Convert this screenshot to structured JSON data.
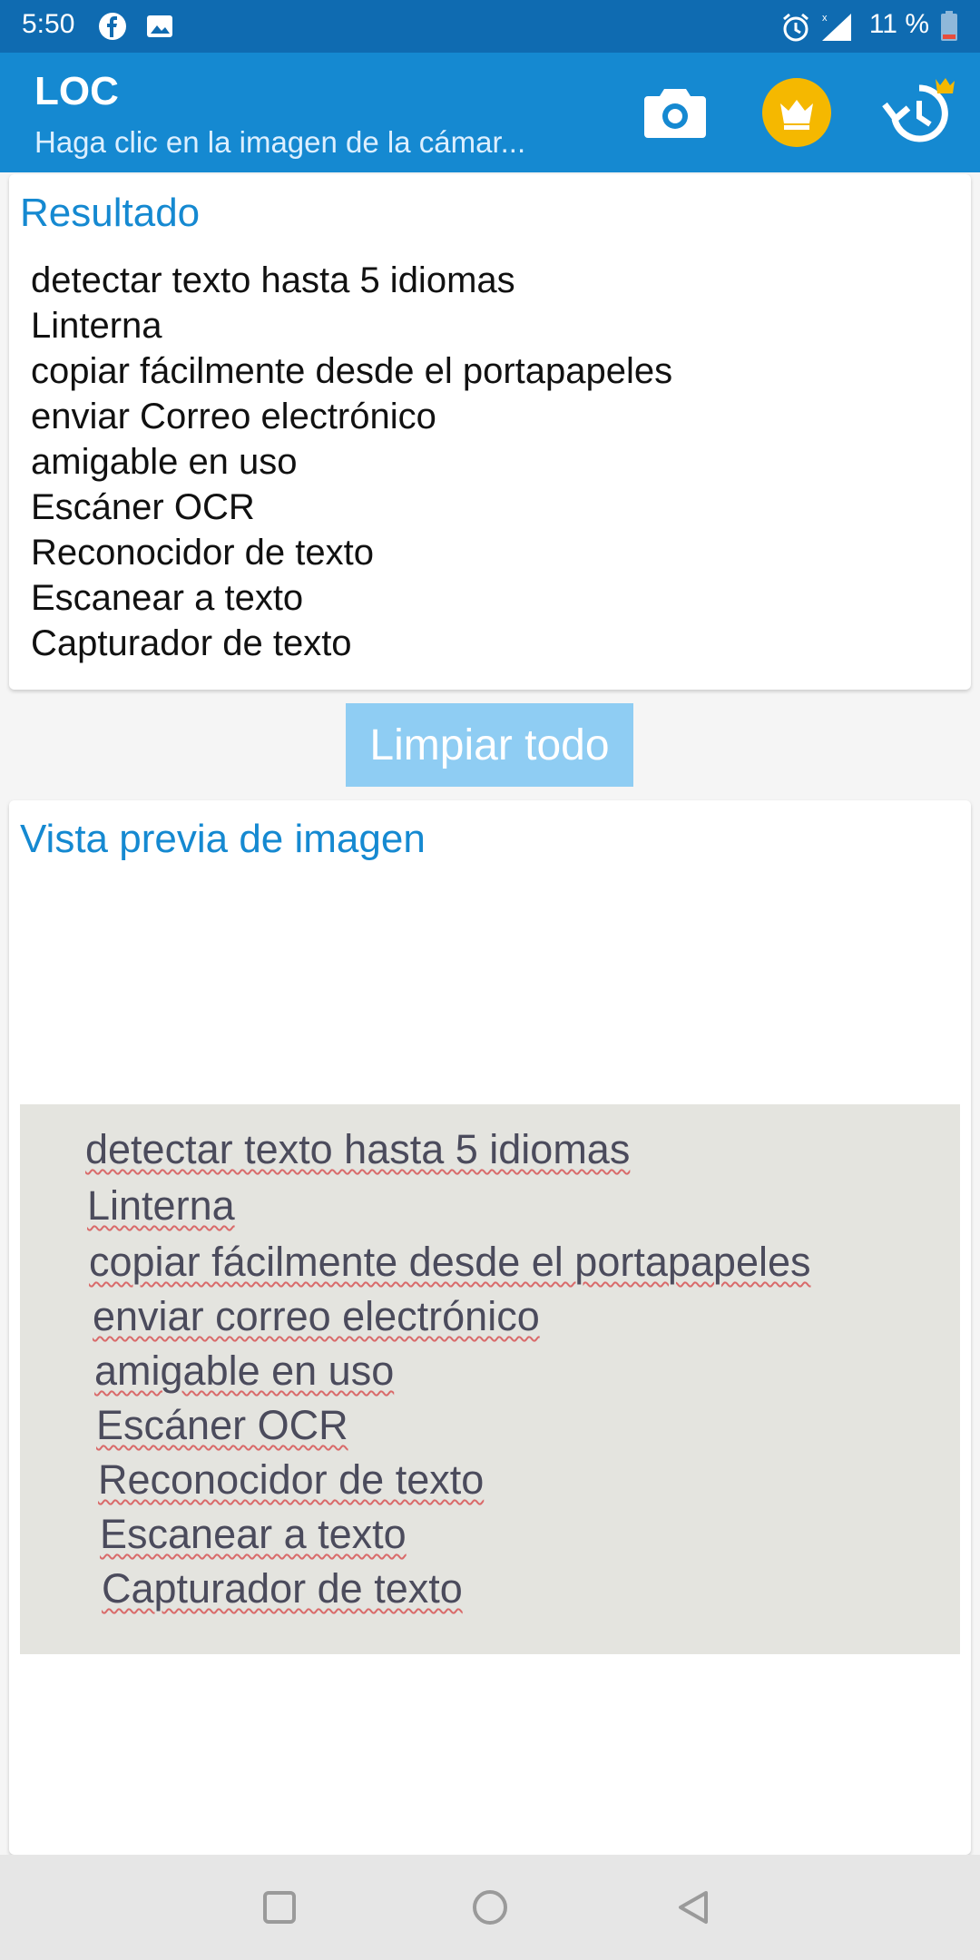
{
  "status_bar": {
    "time": "5:50",
    "battery": "11 %",
    "icons": [
      "facebook-icon",
      "image-icon",
      "alarm-icon",
      "signal-icon",
      "battery-icon"
    ]
  },
  "app_bar": {
    "title": "LOC",
    "subtitle": "Haga clic en la imagen de la cámar...",
    "actions": [
      "camera-icon",
      "crown-icon",
      "history-icon"
    ],
    "colors": {
      "bar": "#1589d1",
      "status": "#0f6bb1",
      "crown_bg": "#f5b800"
    }
  },
  "result": {
    "heading": "Resultado",
    "lines": [
      "detectar texto hasta 5 idiomas",
      "Linterna",
      "copiar fácilmente desde el portapapeles",
      "enviar Correo electrónico",
      "amigable en uso",
      "Escáner OCR",
      "Reconocidor de texto",
      "Escanear a texto",
      "Capturador de texto"
    ]
  },
  "clear_button": {
    "label": "Limpiar todo"
  },
  "preview": {
    "heading": "Vista previa de imagen",
    "image_lines": [
      "detectar texto hasta 5 idiomas",
      "Linterna",
      "copiar fácilmente desde el portapapeles",
      "enviar correo electrónico",
      "amigable en uso",
      "Escáner OCR",
      "Reconocidor de texto",
      "Escanear a texto",
      "Capturador de texto"
    ]
  },
  "nav_bar": {
    "buttons": [
      "recents-icon",
      "home-icon",
      "back-icon"
    ]
  }
}
